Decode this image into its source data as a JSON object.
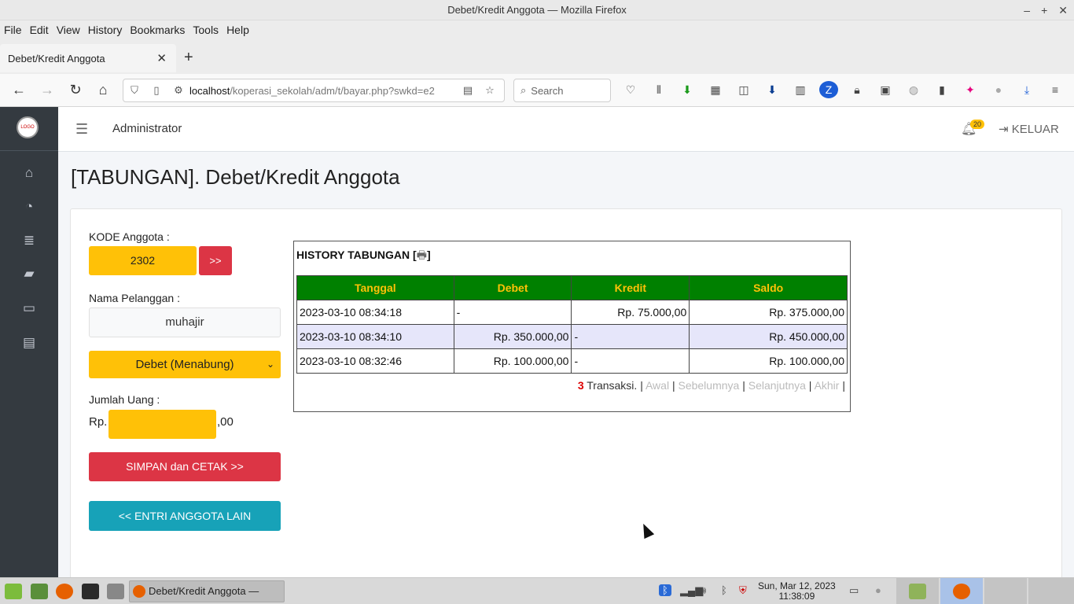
{
  "window": {
    "title": "Debet/Kredit Anggota — Mozilla Firefox"
  },
  "menubar": [
    "File",
    "Edit",
    "View",
    "History",
    "Bookmarks",
    "Tools",
    "Help"
  ],
  "tab": {
    "label": "Debet/Kredit Anggota"
  },
  "urlbar": {
    "host": "localhost",
    "path": "/koperasi_sekolah/adm/t/bayar.php?swkd=e2"
  },
  "search": {
    "placeholder": "Search"
  },
  "topnav": {
    "admin": "Administrator",
    "notif_count": "20",
    "logout": "KELUAR"
  },
  "logo": {
    "text": "LOGO"
  },
  "page": {
    "title": "[TABUNGAN]. Debet/Kredit Anggota"
  },
  "form": {
    "kode_label": "KODE Anggota :",
    "kode_value": "2302",
    "kode_btn": ">>",
    "nama_label": "Nama Pelanggan :",
    "nama_value": "muhajir",
    "jenis_selected": "Debet (Menabung)",
    "jumlah_label": "Jumlah Uang :",
    "rp_prefix": "Rp.",
    "sen_suffix": ",00",
    "simpan_btn": "SIMPAN dan CETAK >>",
    "entri_btn": "<< ENTRI ANGGOTA LAIN"
  },
  "history": {
    "title": "HISTORY TABUNGAN",
    "columns": [
      "Tanggal",
      "Debet",
      "Kredit",
      "Saldo"
    ],
    "rows": [
      {
        "tanggal": "2023-03-10 08:34:18",
        "debet": "-",
        "kredit": "Rp. 75.000,00",
        "saldo": "Rp. 375.000,00"
      },
      {
        "tanggal": "2023-03-10 08:34:10",
        "debet": "Rp. 350.000,00",
        "kredit": "-",
        "saldo": "Rp. 450.000,00"
      },
      {
        "tanggal": "2023-03-10 08:32:46",
        "debet": "Rp. 100.000,00",
        "kredit": "-",
        "saldo": "Rp. 100.000,00"
      }
    ],
    "count": "3",
    "count_label": "Transaksi.",
    "pager": {
      "first": "Awal",
      "prev": "Sebelumnya",
      "next": "Selanjutnya",
      "last": "Akhir"
    }
  },
  "taskbar": {
    "task_label": "Debet/Kredit Anggota — Mo...",
    "date": "Sun, Mar 12, 2023",
    "time": "11:38:09"
  },
  "colors": {
    "yellow": "#ffc107",
    "red": "#dc3545",
    "teal": "#17a2b8",
    "table_header": "#008000"
  }
}
